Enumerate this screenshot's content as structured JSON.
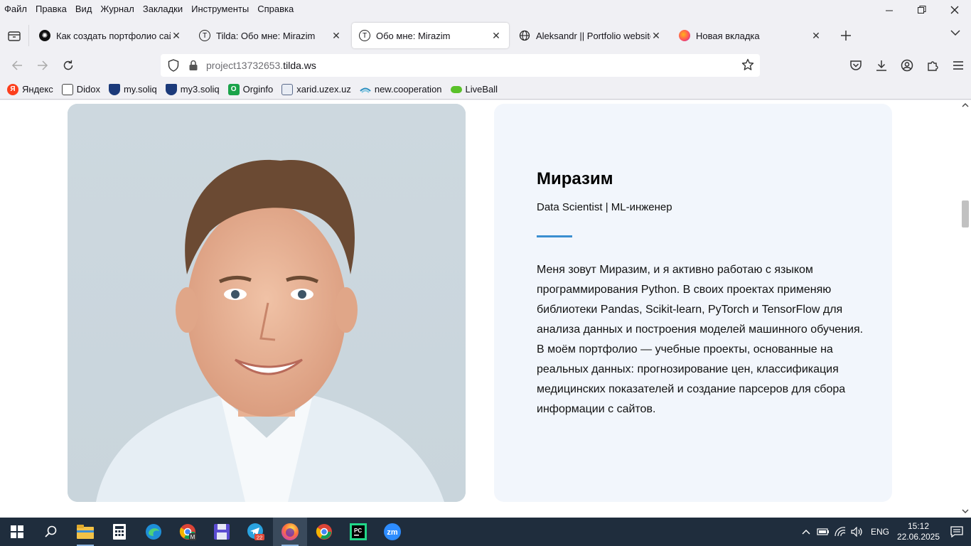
{
  "menu": [
    "Файл",
    "Правка",
    "Вид",
    "Журнал",
    "Закладки",
    "Инструменты",
    "Справка"
  ],
  "tabs": [
    {
      "title": "Как создать портфолио сайт",
      "icon": "chatgpt-icon",
      "active": false
    },
    {
      "title": "Tilda: Обо мне: Mirazim",
      "icon": "tilda-icon",
      "active": false
    },
    {
      "title": "Обо мне: Mirazim",
      "icon": "tilda-icon",
      "active": true
    },
    {
      "title": "Aleksandr || Portfolio website",
      "icon": "globe-icon",
      "active": false
    },
    {
      "title": "Новая вкладка",
      "icon": "firefox-icon",
      "active": false
    }
  ],
  "urlbar": {
    "url_dim": "project13732653.",
    "url_host": "tilda.ws"
  },
  "bookmarks": [
    {
      "label": "Яндекс",
      "icon": "yandex-icon",
      "color": "#fc3f1d"
    },
    {
      "label": "Didox",
      "icon": "document-icon",
      "color": "#444444"
    },
    {
      "label": "my.soliq",
      "icon": "soliq-icon",
      "color": "#1b3a7a"
    },
    {
      "label": "my3.soliq",
      "icon": "soliq-icon",
      "color": "#1b3a7a"
    },
    {
      "label": "Orginfo",
      "icon": "orginfo-icon",
      "color": "#1aa34a"
    },
    {
      "label": "xarid.uzex.uz",
      "icon": "page-icon",
      "color": "#5a6a8a"
    },
    {
      "label": "new.cooperation",
      "icon": "cooperation-icon",
      "color": "#2a8fc0"
    },
    {
      "label": "LiveBall",
      "icon": "liveball-icon",
      "color": "#5ac12a"
    }
  ],
  "profile": {
    "name": "Миразим",
    "role": "Data Scientist | ML-инженер",
    "bio": [
      "Меня зовут Миразим, и я активно работаю с языком программирования Python. В своих проектах применяю библиотеки Pandas, Scikit-learn, PyTorch и TensorFlow для анализа данных и построения моделей машинного обучения.",
      "В моём портфолио — учебные проекты, основанные на реальных данных: прогнозирование цен, классификация медицинских показателей и создание парсеров для сбора информации с сайтов."
    ],
    "accent_color": "#3a8fd0"
  },
  "taskbar": {
    "apps": [
      "windows-start-icon",
      "search-icon",
      "file-explorer-icon",
      "calculator-icon",
      "edge-icon",
      "chrome-profile-icon",
      "save-app-icon",
      "telegram-icon",
      "firefox-icon",
      "chrome-icon",
      "pycharm-icon",
      "zoom-icon"
    ],
    "telegram_badge": "22",
    "lang": "ENG",
    "time": "15:12",
    "date": "22.06.2025"
  }
}
